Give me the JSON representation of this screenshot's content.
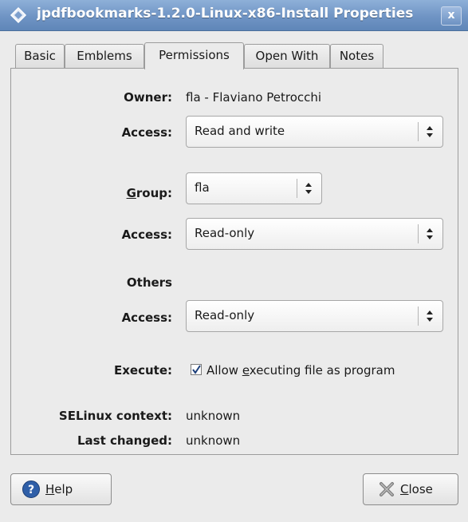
{
  "window": {
    "title": "jpdfbookmarks-1.2.0-Linux-x86-Install Properties",
    "close_glyph": "x"
  },
  "tabs": [
    {
      "label": "Basic",
      "active": false
    },
    {
      "label": "Emblems",
      "active": false
    },
    {
      "label": "Permissions",
      "active": true
    },
    {
      "label": "Open With",
      "active": false
    },
    {
      "label": "Notes",
      "active": false
    }
  ],
  "owner": {
    "label": "Owner:",
    "value": "fla - Flaviano Petrocchi",
    "access_label": "Access:",
    "access_value": "Read and write"
  },
  "group": {
    "label_mnemonic": "G",
    "label_rest": "roup:",
    "value": "fla",
    "access_label": "Access:",
    "access_value": "Read-only"
  },
  "others": {
    "heading": "Others",
    "access_label": "Access:",
    "access_value": "Read-only"
  },
  "execute": {
    "label": "Execute:",
    "checked": true,
    "checkbox_before": "Allow ",
    "checkbox_mnemonic": "e",
    "checkbox_after": "xecuting file as program"
  },
  "selinux": {
    "label": "SELinux context:",
    "value": "unknown"
  },
  "last_changed": {
    "label": "Last changed:",
    "value": "unknown"
  },
  "buttons": {
    "help": {
      "mnemonic": "H",
      "rest": "elp",
      "icon": "help-icon"
    },
    "close": {
      "mnemonic": "C",
      "rest": "lose",
      "icon": "close-icon"
    }
  },
  "colors": {
    "titlebar": "#6f94c4",
    "help_icon": "#2f5fa8"
  }
}
